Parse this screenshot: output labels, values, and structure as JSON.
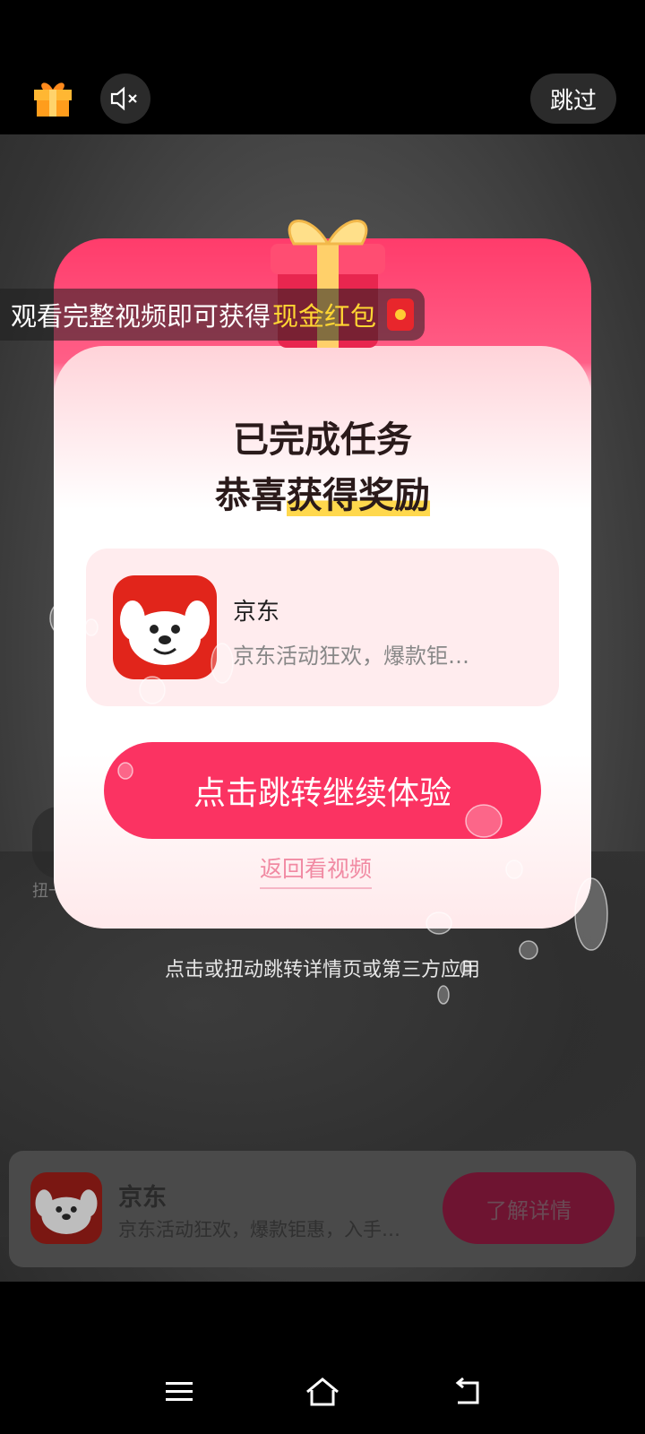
{
  "topbar": {
    "gift_icon": "gift-icon",
    "mute_icon": "speaker-muted-icon",
    "skip_label": "跳过"
  },
  "banner": {
    "text": "观看完整视频即可获得",
    "highlight": "现金红包",
    "icon": "red-envelope-icon"
  },
  "modal": {
    "title_line1": "已完成任务",
    "title_line2_prefix": "恭喜",
    "title_line2_highlight": "获得奖励",
    "app": {
      "name": "京东",
      "description": "京东活动狂欢，爆款钜…"
    },
    "cta_label": "点击跳转继续体验",
    "back_label": "返回看视频"
  },
  "hint": "点击或扭动跳转详情页或第三方应用",
  "side_label": "扭一",
  "bottom_card": {
    "name": "京东",
    "description": "京东活动狂欢，爆款钜惠，入手…",
    "button_label": "了解详情"
  },
  "navbar": {
    "menu_icon": "menu-icon",
    "home_icon": "home-icon",
    "back_icon": "back-icon"
  },
  "colors": {
    "accent": "#fb3362",
    "highlight_yellow": "#ffd633",
    "jd_red": "#e1251b"
  }
}
